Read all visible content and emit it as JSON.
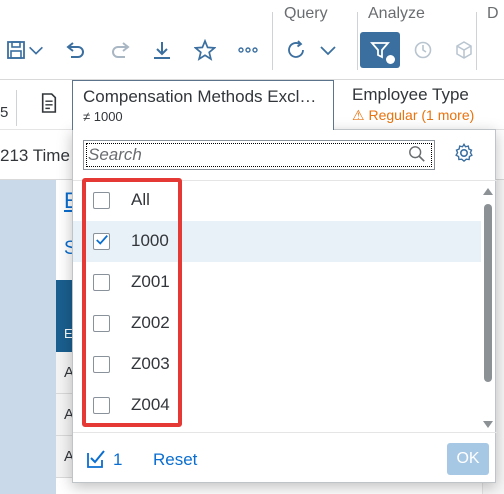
{
  "toolbar": {
    "groups": {
      "query": "Query",
      "analyze": "Analyze",
      "next": "D"
    },
    "icons": [
      "save-icon",
      "chevron-down-icon",
      "undo-icon",
      "redo-icon",
      "download-icon",
      "star-icon",
      "more-icon",
      "refresh-icon",
      "chevron-down-icon",
      "filter-icon",
      "history-icon",
      "cube-icon"
    ]
  },
  "filterbar": {
    "left_number": "5",
    "token_title": "Compensation Methods Excl…",
    "token_value": "≠ 1000",
    "employee_type_label": "Employee Type",
    "employee_type_value": "Regular (1 more)"
  },
  "background": {
    "time_text": "213 Time",
    "title_letter": "E",
    "subtitle_letter": "S",
    "header_letter": "E",
    "row_letter": "A"
  },
  "popover": {
    "search_placeholder": "Search",
    "items": [
      {
        "label": "All",
        "checked": false
      },
      {
        "label": "1000",
        "checked": true
      },
      {
        "label": "Z001",
        "checked": false
      },
      {
        "label": "Z002",
        "checked": false
      },
      {
        "label": "Z003",
        "checked": false
      },
      {
        "label": "Z004",
        "checked": false
      }
    ],
    "selected_count": "1",
    "reset_label": "Reset",
    "ok_label": "OK"
  },
  "colors": {
    "accent": "#0a6ed1",
    "filter_button": "#3b6fa0",
    "highlight_box": "#e53935",
    "warning": "#e9730c"
  }
}
